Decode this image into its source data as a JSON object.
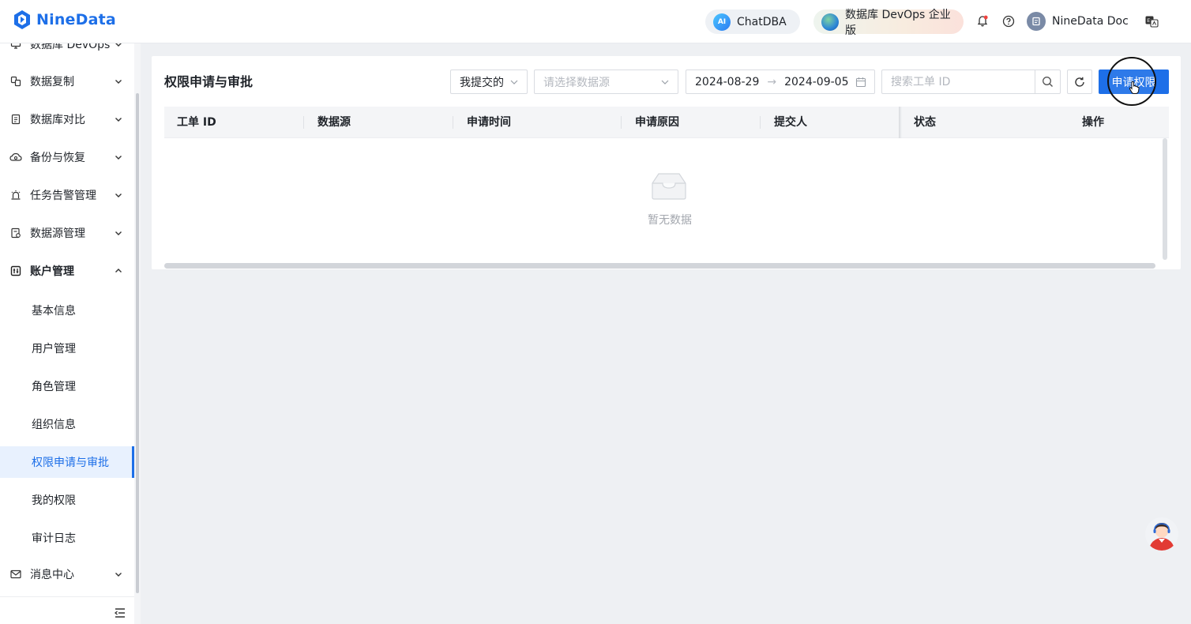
{
  "header": {
    "logo_text": "NineData",
    "chatdba_label": "ChatDBA",
    "chatdba_icon_text": "AI",
    "devops_label": "数据库 DevOps 企业版",
    "user_name": "NineData Doc",
    "brand_color": "#1d6fe8",
    "icons": [
      "notification-bell-icon",
      "help-icon",
      "user-avatar",
      "language-switch-icon"
    ]
  },
  "sidebar": {
    "items": [
      {
        "label": "数据库 DevOps",
        "icon": "database-devops-icon",
        "expanded": false
      },
      {
        "label": "数据复制",
        "icon": "replication-icon",
        "expanded": false
      },
      {
        "label": "数据库对比",
        "icon": "compare-icon",
        "expanded": false
      },
      {
        "label": "备份与恢复",
        "icon": "cloud-backup-icon",
        "expanded": false
      },
      {
        "label": "任务告警管理",
        "icon": "alarm-icon",
        "expanded": false
      },
      {
        "label": "数据源管理",
        "icon": "datasource-icon",
        "expanded": false
      },
      {
        "label": "账户管理",
        "icon": "account-icon",
        "expanded": true
      },
      {
        "label": "消息中心",
        "icon": "mail-icon",
        "expanded": false
      }
    ],
    "account_subitems": [
      "基本信息",
      "用户管理",
      "角色管理",
      "组织信息",
      "权限申请与审批",
      "我的权限",
      "审计日志"
    ],
    "active_subitem": "权限申请与审批"
  },
  "main": {
    "title": "权限申请与审批",
    "filter_mine": "我提交的",
    "datasource_placeholder": "请选择数据源",
    "date_start": "2024-08-29",
    "date_sep": "→",
    "date_end": "2024-09-05",
    "search_placeholder": "搜索工单 ID",
    "apply_button": "申请权限",
    "columns": [
      "工单 ID",
      "数据源",
      "申请时间",
      "申请原因",
      "提交人",
      "状态",
      "操作"
    ],
    "rows": [],
    "empty_text": "暂无数据"
  }
}
